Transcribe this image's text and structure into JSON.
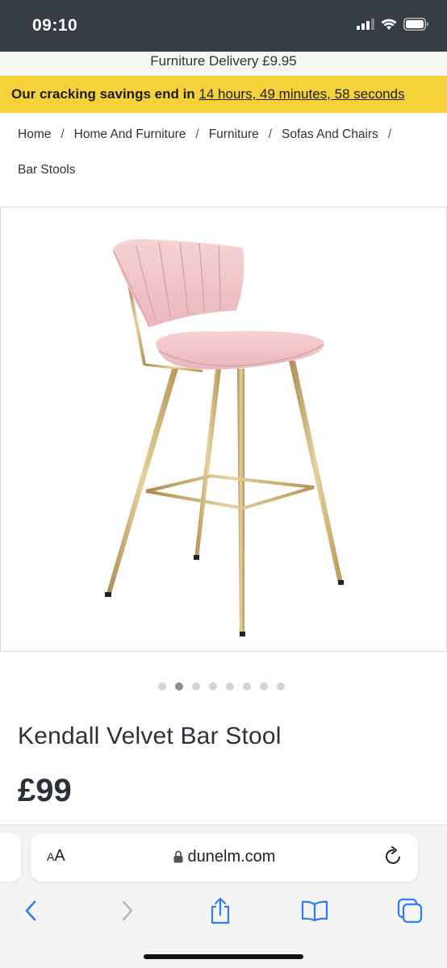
{
  "status_bar": {
    "time": "09:10",
    "icons": [
      "signal-icon",
      "wifi-icon",
      "battery-icon"
    ]
  },
  "delivery_banner": {
    "text": "Furniture Delivery £9.95"
  },
  "savings_banner": {
    "lead": "Our cracking savings end in",
    "countdown": "14 hours, 49 minutes, 58 seconds",
    "background": "#f6d23a"
  },
  "breadcrumb": {
    "items": [
      "Home",
      "Home And Furniture",
      "Furniture",
      "Sofas And Chairs",
      "Bar Stools"
    ],
    "separator": "/"
  },
  "gallery": {
    "image_description_icon": "bar-stool-product-image",
    "dot_count": 8,
    "active_index": 1
  },
  "product": {
    "title": "Kendall Velvet Bar Stool",
    "price": "£99"
  },
  "browser": {
    "aa_label_small": "A",
    "aa_label_large": "A",
    "url": "dunelm.com",
    "toolbar_icons": [
      "back-icon",
      "forward-icon",
      "share-icon",
      "bookmarks-icon",
      "tabs-icon"
    ]
  },
  "colors": {
    "status_bar": "#363d42",
    "delivery_bg": "#f3f8f2",
    "ios_blue": "#2f7cf6",
    "stool_pink": "#f2c9cc",
    "stool_gold": "#c8aa6a"
  }
}
